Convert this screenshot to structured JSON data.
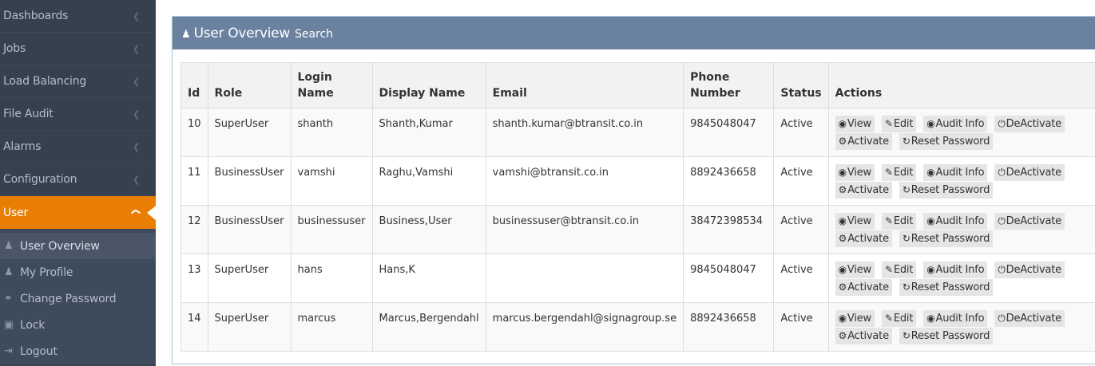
{
  "sidebar": {
    "items": [
      {
        "label": "Dashboards"
      },
      {
        "label": "Jobs"
      },
      {
        "label": "Load Balancing"
      },
      {
        "label": "File Audit"
      },
      {
        "label": "Alarms"
      },
      {
        "label": "Configuration"
      },
      {
        "label": "User"
      }
    ],
    "sub_items": [
      {
        "label": "User Overview",
        "icon": "user-icon"
      },
      {
        "label": "My Profile",
        "icon": "user-icon"
      },
      {
        "label": "Change Password",
        "icon": "key-icon"
      },
      {
        "label": "Lock",
        "icon": "lock-icon"
      },
      {
        "label": "Logout",
        "icon": "logout-icon"
      }
    ],
    "active_color": "#e87e04",
    "background": "#364150"
  },
  "header": {
    "title": "User Overview",
    "subtitle": "Search",
    "icon": "user-icon",
    "background": "#6a819f"
  },
  "table": {
    "columns": [
      "Id",
      "Role",
      "Login Name",
      "Display Name",
      "Email",
      "Phone Number",
      "Status",
      "Actions"
    ],
    "rows": [
      {
        "id": "10",
        "role": "SuperUser",
        "login": "shanth",
        "display": "Shanth,Kumar",
        "email": "shanth.kumar@btransit.co.in",
        "phone": "9845048047",
        "status": "Active"
      },
      {
        "id": "11",
        "role": "BusinessUser",
        "login": "vamshi",
        "display": "Raghu,Vamshi",
        "email": "vamshi@btransit.co.in",
        "phone": "8892436658",
        "status": "Active"
      },
      {
        "id": "12",
        "role": "BusinessUser",
        "login": "businessuser",
        "display": "Business,User",
        "email": "businessuser@btransit.co.in",
        "phone": "38472398534",
        "status": "Active"
      },
      {
        "id": "13",
        "role": "SuperUser",
        "login": "hans",
        "display": "Hans,K",
        "email": "",
        "phone": "9845048047",
        "status": "Active"
      },
      {
        "id": "14",
        "role": "SuperUser",
        "login": "marcus",
        "display": "Marcus,Bergendahl",
        "email": "marcus.bergendahl@signagroup.se",
        "phone": "8892436658",
        "status": "Active"
      }
    ],
    "actions": {
      "view": "View",
      "edit": "Edit",
      "audit": "Audit Info",
      "deactivate": "DeActivate",
      "activate": "Activate",
      "reset": "Reset Password"
    }
  }
}
